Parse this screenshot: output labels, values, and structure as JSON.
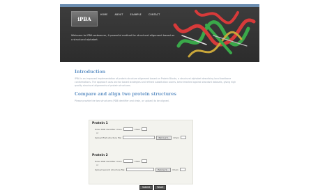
{
  "header": {
    "logo_text": "iPBA",
    "nav": [
      "HOME",
      "ABOUT",
      "EXAMPLE",
      "CONTACT"
    ],
    "welcome": "Welcome to iPBA webserver, A powerful method for structural alignment based on a structural alphabet."
  },
  "intro": {
    "title": "Introduction",
    "text": "iPBA is an improved implementation of protein structure alignment based on Protein Blocks, a structural alphabet describing local backbone conformations. The approach uses anchor based strategies and refined substitution scores, benchmarked against standard datasets, giving high quality structural alignments of protein structures."
  },
  "compare": {
    "title": "Compare and align two protein structures",
    "subtitle": "Please provide the two structures (PDB identifier and chain, or upload) to be aligned."
  },
  "form": {
    "protein1": {
      "title": "Protein 1",
      "pdb_label": "Enter PDB identifier chain",
      "chain_label": "Chain",
      "or_label": "or",
      "upload_label": "Upload first structure file:",
      "browse_label": "Parcourir...",
      "chain2_label": "Chain"
    },
    "protein2": {
      "title": "Protein 2",
      "pdb_label": "Enter PDB identifier chain",
      "chain_label": "Chain",
      "or_label": "or",
      "upload_label": "Upload second structure file:",
      "browse_label": "Parcourir...",
      "chain2_label": "Chain"
    },
    "submit_label": "Submit",
    "reset_label": "Reset"
  },
  "colors": {
    "header_bg": "#333333",
    "title_blue": "#6a98c8",
    "helix_red": "#d73a3a",
    "strand_green": "#3aa84a"
  }
}
